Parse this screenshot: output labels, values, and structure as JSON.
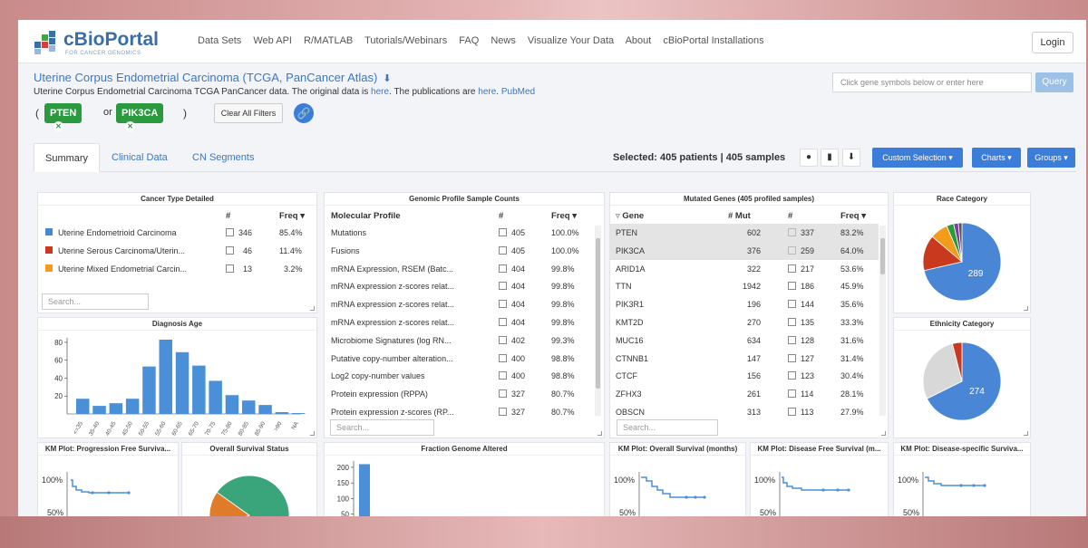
{
  "brand": {
    "name": "cBioPortal",
    "tagline": "FOR CANCER GENOMICS"
  },
  "nav": {
    "links": [
      "Data Sets",
      "Web API",
      "R/MATLAB",
      "Tutorials/Webinars",
      "FAQ",
      "News",
      "Visualize Your Data",
      "About",
      "cBioPortal Installations"
    ],
    "login": "Login"
  },
  "study": {
    "title": "Uterine Corpus Endometrial Carcinoma (TCGA, PanCancer Atlas)",
    "desc_prefix": "Uterine Corpus Endometrial Carcinoma TCGA PanCancer data. The original data is ",
    "here1": "here",
    "desc_mid": ". The publications are ",
    "here2": "here",
    "dot": ". ",
    "pubmed": "PubMed"
  },
  "gene_query": {
    "placeholder": "Click gene symbols below or enter here",
    "button": "Query"
  },
  "filters": {
    "open": "(",
    "gene1": "PTEN",
    "or": "or",
    "gene2": "PIK3CA",
    "close": ")",
    "clear": "Clear All Filters"
  },
  "tabs": [
    "Summary",
    "Clinical Data",
    "CN Segments"
  ],
  "selection": {
    "text": "Selected: 405 patients | 405 samples",
    "custom": "Custom Selection",
    "charts": "Charts",
    "groups": "Groups"
  },
  "colors": {
    "accent": "#3b7dd8",
    "filter_green": "#2b9a3e",
    "bar_blue": "#4a90d9"
  },
  "cancer_type": {
    "title": "Cancer Type Detailed",
    "headers": [
      "#",
      "Freq"
    ],
    "rows": [
      {
        "name": "Uterine Endometrioid Carcinoma",
        "count": "346",
        "freq": "85.4%",
        "color": "#4a86d6"
      },
      {
        "name": "Uterine Serous Carcinoma/Uterin...",
        "count": "46",
        "freq": "11.4%",
        "color": "#c8391e"
      },
      {
        "name": "Uterine Mixed Endometrial Carcin...",
        "count": "13",
        "freq": "3.2%",
        "color": "#f29b1d"
      }
    ],
    "search": "Search..."
  },
  "genomic_profile": {
    "title": "Genomic Profile Sample Counts",
    "headers": [
      "Molecular Profile",
      "#",
      "Freq"
    ],
    "rows": [
      {
        "name": "Mutations",
        "count": "405",
        "freq": "100.0%"
      },
      {
        "name": "Fusions",
        "count": "405",
        "freq": "100.0%"
      },
      {
        "name": "mRNA Expression, RSEM (Batc...",
        "count": "404",
        "freq": "99.8%"
      },
      {
        "name": "mRNA expression z-scores relat...",
        "count": "404",
        "freq": "99.8%"
      },
      {
        "name": "mRNA expression z-scores relat...",
        "count": "404",
        "freq": "99.8%"
      },
      {
        "name": "mRNA expression z-scores relat...",
        "count": "404",
        "freq": "99.8%"
      },
      {
        "name": "Microbiome Signatures (log RN...",
        "count": "402",
        "freq": "99.3%"
      },
      {
        "name": "Putative copy-number alteration...",
        "count": "400",
        "freq": "98.8%"
      },
      {
        "name": "Log2 copy-number values",
        "count": "400",
        "freq": "98.8%"
      },
      {
        "name": "Protein expression (RPPA)",
        "count": "327",
        "freq": "80.7%"
      },
      {
        "name": "Protein expression z-scores (RP...",
        "count": "327",
        "freq": "80.7%"
      }
    ],
    "search": "Search..."
  },
  "mutated_genes": {
    "title": "Mutated Genes (405 profiled samples)",
    "headers": [
      "Gene",
      "# Mut",
      "#",
      "Freq"
    ],
    "rows": [
      {
        "gene": "PTEN",
        "mut": "602",
        "count": "337",
        "freq": "83.2%",
        "selected": true
      },
      {
        "gene": "PIK3CA",
        "mut": "376",
        "count": "259",
        "freq": "64.0%",
        "selected": true
      },
      {
        "gene": "ARID1A",
        "mut": "322",
        "count": "217",
        "freq": "53.6%",
        "selected": false
      },
      {
        "gene": "TTN",
        "mut": "1942",
        "count": "186",
        "freq": "45.9%",
        "selected": false
      },
      {
        "gene": "PIK3R1",
        "mut": "196",
        "count": "144",
        "freq": "35.6%",
        "selected": false
      },
      {
        "gene": "KMT2D",
        "mut": "270",
        "count": "135",
        "freq": "33.3%",
        "selected": false
      },
      {
        "gene": "MUC16",
        "mut": "634",
        "count": "128",
        "freq": "31.6%",
        "selected": false
      },
      {
        "gene": "CTNNB1",
        "mut": "147",
        "count": "127",
        "freq": "31.4%",
        "selected": false
      },
      {
        "gene": "CTCF",
        "mut": "156",
        "count": "123",
        "freq": "30.4%",
        "selected": false
      },
      {
        "gene": "ZFHX3",
        "mut": "261",
        "count": "114",
        "freq": "28.1%",
        "selected": false
      },
      {
        "gene": "OBSCN",
        "mut": "313",
        "count": "113",
        "freq": "27.9%",
        "selected": false
      }
    ],
    "search": "Search..."
  },
  "race": {
    "title": "Race Category",
    "label": "289"
  },
  "ethnicity": {
    "title": "Ethnicity Category",
    "label": "274"
  },
  "diagnosis_age": {
    "title": "Diagnosis Age"
  },
  "km_pfs": {
    "title": "KM Plot: Progression Free Surviva...",
    "y_top": "100%",
    "y_mid": "50%"
  },
  "overall_status": {
    "title": "Overall Survival Status"
  },
  "fga": {
    "title": "Fraction Genome Altered"
  },
  "km_os": {
    "title": "KM Plot: Overall Survival (months)",
    "y_top": "100%",
    "y_mid": "50%"
  },
  "km_dfs": {
    "title": "KM Plot: Disease Free Survival (m...",
    "y_top": "100%",
    "y_mid": "50%"
  },
  "km_dss": {
    "title": "KM Plot: Disease-specific Surviva...",
    "y_top": "100%",
    "y_mid": "50%"
  },
  "chart_data": [
    {
      "type": "bar",
      "title": "Diagnosis Age",
      "categories": [
        "<=35",
        "35-40",
        "40-45",
        "45-50",
        "50-55",
        "55-60",
        "60-65",
        "65-70",
        "70-75",
        "75-80",
        "80-85",
        "85-90",
        ">90",
        "NA"
      ],
      "values": [
        17,
        9,
        12,
        17,
        53,
        83,
        69,
        54,
        37,
        21,
        15,
        10,
        2,
        1
      ],
      "ylim": [
        0,
        85
      ],
      "yticks": [
        "80",
        "60",
        "40",
        "20"
      ]
    },
    {
      "type": "pie",
      "title": "Race Category",
      "slices": [
        {
          "label": "289",
          "value": 289,
          "color": "#4a86d6"
        },
        {
          "value": 60,
          "color": "#c8391e"
        },
        {
          "value": 30,
          "color": "#f29b1d"
        },
        {
          "value": 12,
          "color": "#2b9a3e"
        },
        {
          "value": 8,
          "color": "#7b3fa0"
        },
        {
          "value": 6,
          "color": "#555555"
        }
      ]
    },
    {
      "type": "pie",
      "title": "Ethnicity Category",
      "slices": [
        {
          "label": "274",
          "value": 274,
          "color": "#4a86d6"
        },
        {
          "value": 115,
          "color": "#d8d8d8"
        },
        {
          "value": 16,
          "color": "#c8391e"
        }
      ]
    },
    {
      "type": "pie",
      "title": "Overall Survival Status",
      "slices": [
        {
          "value": 345,
          "color": "#3aa57a"
        },
        {
          "value": 60,
          "color": "#e07b2a"
        }
      ]
    },
    {
      "type": "bar",
      "title": "Fraction Genome Altered",
      "values": [
        210
      ],
      "ylim": [
        0,
        220
      ],
      "yticks": [
        "200",
        "150",
        "100",
        "50"
      ]
    }
  ]
}
